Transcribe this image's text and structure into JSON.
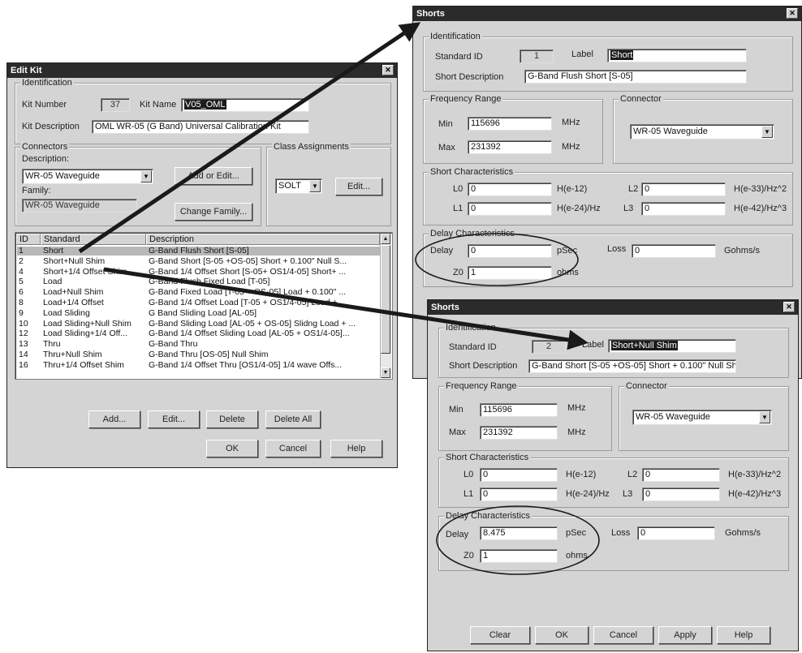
{
  "edit_kit": {
    "title": "Edit Kit",
    "identification_legend": "Identification",
    "kit_number_label": "Kit Number",
    "kit_number_value": "37",
    "kit_name_label": "Kit Name",
    "kit_name_value": "V05_OML",
    "kit_description_label": "Kit Description",
    "kit_description_value": "OML WR-05 (G Band) Universal Calibration Kit",
    "connectors_legend": "Connectors",
    "description_label": "Description:",
    "description_value": "WR-05 Waveguide",
    "add_or_edit_label": "Add or Edit...",
    "family_label": "Family:",
    "family_value": "WR-05 Waveguide",
    "change_family_label": "Change Family...",
    "class_assignments_legend": "Class Assignments",
    "class_value": "SOLT",
    "class_edit_label": "Edit...",
    "list_headers": {
      "id": "ID",
      "standard": "Standard",
      "description": "Description"
    },
    "standards": [
      {
        "id": "1",
        "standard": "Short",
        "description": "G-Band Flush Short [S-05]"
      },
      {
        "id": "2",
        "standard": "Short+Null Shim",
        "description": "G-Band  Short [S-05 +OS-05] Short + 0.100\" Null S..."
      },
      {
        "id": "4",
        "standard": "Short+1/4 Offset Shim",
        "description": "G-Band 1/4 Offset Short [S-05+ OS1/4-05] Short+ ..."
      },
      {
        "id": "5",
        "standard": "Load",
        "description": "G-Band Flush Fixed Load [T-05]"
      },
      {
        "id": "6",
        "standard": "Load+Null Shim",
        "description": "G-Band Fixed Load [T-05 + OS-05] Load + 0.100\" ..."
      },
      {
        "id": "8",
        "standard": "Load+1/4 Offset",
        "description": "G-Band 1/4 Offset Load [T-05 + OS1/4-05] Load + ..."
      },
      {
        "id": "9",
        "standard": "Load Sliding",
        "description": "G Band Sliding Load [AL-05]"
      },
      {
        "id": "10",
        "standard": "Load Sliding+Null Shim",
        "description": "G-Band Sliding Load [AL-05 + OS-05] Slidng Load + ..."
      },
      {
        "id": "12",
        "standard": "Load Sliding+1/4 Off...",
        "description": "G-Band 1/4 Offset Sliding Load [AL-05 + OS1/4-05]..."
      },
      {
        "id": "13",
        "standard": "Thru",
        "description": "G-Band Thru"
      },
      {
        "id": "14",
        "standard": "Thru+Null Shim",
        "description": "G-Band Thru [OS-05] Null Shim"
      },
      {
        "id": "16",
        "standard": "Thru+1/4 Offset Shim",
        "description": "G-Band 1/4 Offset Thru [OS1/4-05] 1/4 wave Offs..."
      }
    ],
    "buttons": {
      "add": "Add...",
      "edit": "Edit...",
      "delete": "Delete",
      "delete_all": "Delete All",
      "ok": "OK",
      "cancel": "Cancel",
      "help": "Help"
    }
  },
  "shorts_1": {
    "title": "Shorts",
    "identification_legend": "Identification",
    "standard_id_label": "Standard ID",
    "standard_id_value": "1",
    "label_label": "Label",
    "label_value": "Short",
    "short_description_label": "Short Description",
    "short_description_value": "G-Band Flush Short [S-05]",
    "frequency_legend": "Frequency Range",
    "min_label": "Min",
    "min_value": "115696",
    "max_label": "Max",
    "max_value": "231392",
    "mhz_unit": "MHz",
    "connector_legend": "Connector",
    "connector_value": "WR-05 Waveguide",
    "short_char_legend": "Short Characteristics",
    "l0_label": "L0",
    "l0_value": "0",
    "l0_unit": "H(e-12)",
    "l1_label": "L1",
    "l1_value": "0",
    "l1_unit": "H(e-24)/Hz",
    "l2_label": "L2",
    "l2_value": "0",
    "l2_unit": "H(e-33)/Hz^2",
    "l3_label": "L3",
    "l3_value": "0",
    "l3_unit": "H(e-42)/Hz^3",
    "delay_legend": "Delay Characteristics",
    "delay_label": "Delay",
    "delay_value": "0",
    "delay_unit": "pSec",
    "loss_label": "Loss",
    "loss_value": "0",
    "loss_unit": "Gohms/s",
    "z0_label": "Z0",
    "z0_value": "1",
    "z0_unit": "ohms"
  },
  "shorts_2": {
    "title": "Shorts",
    "identification_legend": "Identification",
    "standard_id_label": "Standard ID",
    "standard_id_value": "2",
    "label_label": "Label",
    "label_value": "Short+Null Shim",
    "short_description_label": "Short Description",
    "short_description_value": "G-Band  Short [S-05 +OS-05] Short + 0.100\" Null Sh",
    "frequency_legend": "Frequency Range",
    "min_label": "Min",
    "min_value": "115696",
    "max_label": "Max",
    "max_value": "231392",
    "mhz_unit": "MHz",
    "connector_legend": "Connector",
    "connector_value": "WR-05 Waveguide",
    "short_char_legend": "Short Characteristics",
    "l0_label": "L0",
    "l0_value": "0",
    "l0_unit": "H(e-12)",
    "l1_label": "L1",
    "l1_value": "0",
    "l1_unit": "H(e-24)/Hz",
    "l2_label": "L2",
    "l2_value": "0",
    "l2_unit": "H(e-33)/Hz^2",
    "l3_label": "L3",
    "l3_value": "0",
    "l3_unit": "H(e-42)/Hz^3",
    "delay_legend": "Delay Characteristics",
    "delay_label": "Delay",
    "delay_value": "8.475",
    "delay_unit": "pSec",
    "loss_label": "Loss",
    "loss_value": "0",
    "loss_unit": "Gohms/s",
    "z0_label": "Z0",
    "z0_value": "1",
    "z0_unit": "ohms",
    "buttons": {
      "clear": "Clear",
      "ok": "OK",
      "cancel": "Cancel",
      "apply": "Apply",
      "help": "Help"
    }
  }
}
